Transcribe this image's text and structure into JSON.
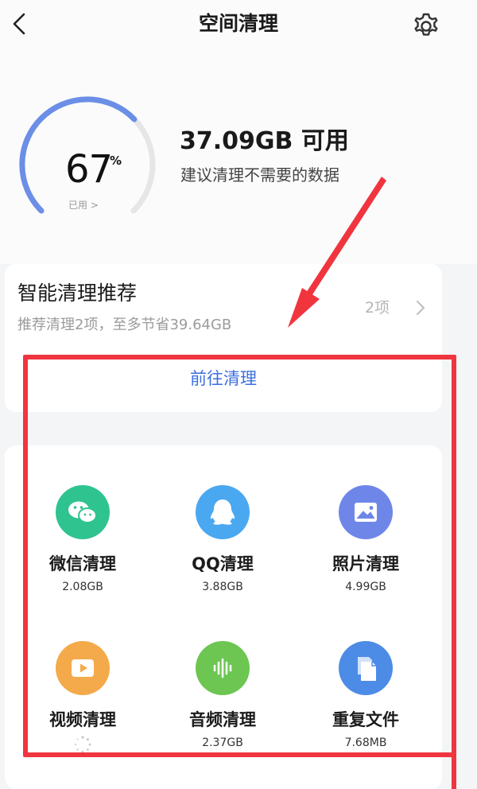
{
  "header": {
    "title": "空间清理",
    "back_icon": "chevron-left-icon",
    "settings_icon": "gear-icon"
  },
  "storage": {
    "used_percent": 67,
    "used_percent_text": "67",
    "percent_sign": "%",
    "used_label": "已用 >",
    "available": "37.09GB 可用",
    "suggestion": "建议清理不需要的数据",
    "gauge_color": "#6b8fe6",
    "gauge_track_color": "#e6e6e8"
  },
  "smart_clean": {
    "title": "智能清理推荐",
    "subtitle": "推荐清理2项，至多节省39.64GB",
    "count": "2项",
    "action": "前往清理",
    "action_color": "#3d6fe0"
  },
  "categories": [
    {
      "name": "微信清理",
      "size": "2.08GB",
      "icon": "wechat-icon",
      "color": "#2fc38f"
    },
    {
      "name": "QQ清理",
      "size": "3.88GB",
      "icon": "qq-icon",
      "color": "#4aa8f0"
    },
    {
      "name": "照片清理",
      "size": "4.99GB",
      "icon": "photo-icon",
      "color": "#6f86e9"
    },
    {
      "name": "视频清理",
      "size": "",
      "icon": "video-icon",
      "color": "#f4aa4a",
      "loading": true
    },
    {
      "name": "音频清理",
      "size": "2.37GB",
      "icon": "audio-icon",
      "color": "#6cc651"
    },
    {
      "name": "重复文件",
      "size": "7.68MB",
      "icon": "duplicate-file-icon",
      "color": "#4d8ce6"
    }
  ],
  "annotation": {
    "color": "#f0353f"
  }
}
